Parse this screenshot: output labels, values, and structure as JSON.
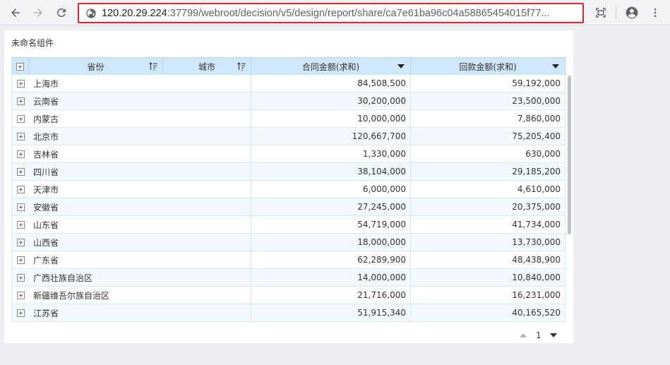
{
  "browser": {
    "url_host": "120.20.29.224",
    "url_path": ":37799/webroot/decision/v5/design/report/share/ca7e61ba96c04a58865454015f77..."
  },
  "widget": {
    "title": "未命名组件",
    "columns": {
      "province": "省份",
      "city": "城市",
      "contract": "合同金额(求和)",
      "payment": "回款金额(求和)"
    },
    "rows": [
      {
        "province": "上海市",
        "contract": "84,508,500",
        "payment": "59,192,000"
      },
      {
        "province": "云南省",
        "contract": "30,200,000",
        "payment": "23,500,000"
      },
      {
        "province": "内蒙古",
        "contract": "10,000,000",
        "payment": "7,860,000"
      },
      {
        "province": "北京市",
        "contract": "120,667,700",
        "payment": "75,205,400"
      },
      {
        "province": "吉林省",
        "contract": "1,330,000",
        "payment": "630,000"
      },
      {
        "province": "四川省",
        "contract": "38,104,000",
        "payment": "29,185,200"
      },
      {
        "province": "天津市",
        "contract": "6,000,000",
        "payment": "4,610,000"
      },
      {
        "province": "安徽省",
        "contract": "27,245,000",
        "payment": "20,375,000"
      },
      {
        "province": "山东省",
        "contract": "54,719,000",
        "payment": "41,734,000"
      },
      {
        "province": "山西省",
        "contract": "18,000,000",
        "payment": "13,730,000"
      },
      {
        "province": "广东省",
        "contract": "62,289,900",
        "payment": "48,438,900"
      },
      {
        "province": "广西壮族自治区",
        "contract": "14,000,000",
        "payment": "10,840,000"
      },
      {
        "province": "新疆维吾尔族自治区",
        "contract": "21,716,000",
        "payment": "16,231,000"
      },
      {
        "province": "江苏省",
        "contract": "51,915,340",
        "payment": "40,165,520"
      }
    ],
    "pagination": {
      "current_page": "1"
    }
  },
  "colors": {
    "header_bg": "#cfe7fb",
    "row_alt_bg": "#f3f9fe",
    "address_highlight": "#e3262e"
  },
  "icons": [
    "back-arrow-icon",
    "forward-arrow-icon",
    "reload-icon",
    "site-info-icon",
    "screen-capture-icon",
    "profile-icon",
    "kebab-menu-icon",
    "expand-plus-icon",
    "sort-icon",
    "dropdown-triangle-icon"
  ]
}
